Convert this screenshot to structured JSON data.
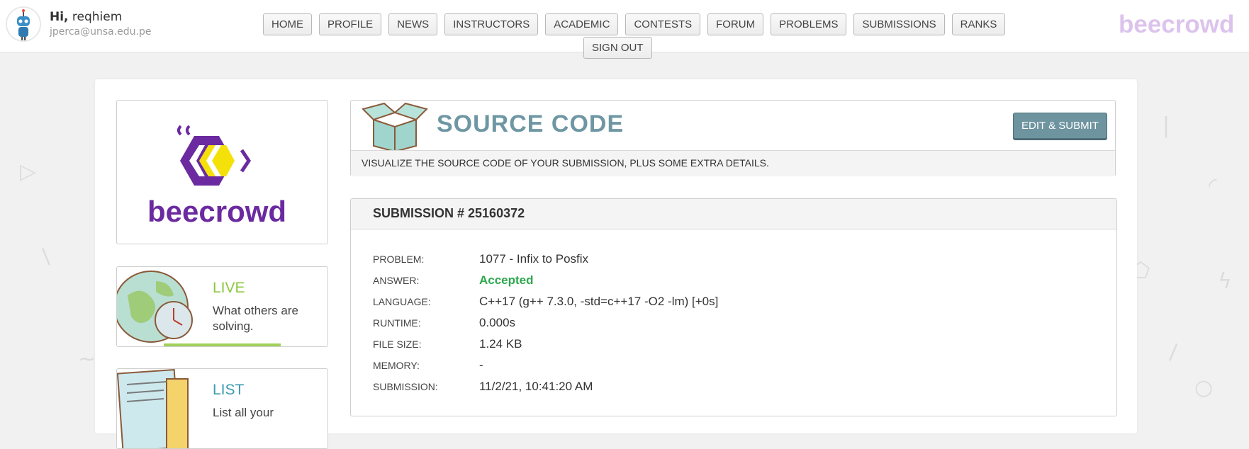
{
  "user": {
    "greeting_prefix": "Hi,",
    "name": "reqhiem",
    "email": "jperca@unsa.edu.pe",
    "avatar_icon": "robot-avatar-icon"
  },
  "nav": [
    {
      "label": "HOME"
    },
    {
      "label": "PROFILE"
    },
    {
      "label": "NEWS"
    },
    {
      "label": "INSTRUCTORS"
    },
    {
      "label": "ACADEMIC"
    },
    {
      "label": "CONTESTS"
    },
    {
      "label": "FORUM"
    },
    {
      "label": "PROBLEMS"
    },
    {
      "label": "SUBMISSIONS"
    },
    {
      "label": "RANKS"
    }
  ],
  "signout_label": "SIGN OUT",
  "brand": "beecrowd",
  "colors": {
    "brand_purple": "#6b2aa0",
    "brand_light": "#dcc3ec",
    "accent_teal": "#6e97a3",
    "accepted_green": "#2ea84f",
    "live_green": "#8cc63f",
    "list_teal": "#3b9bb0"
  },
  "sidebar": {
    "logo_text": "beecrowd",
    "cards": [
      {
        "title": "LIVE",
        "desc": "What others are solving.",
        "icon": "globe-clock-icon"
      },
      {
        "title": "LIST",
        "desc": "List all your",
        "icon": "paper-list-icon"
      }
    ]
  },
  "source": {
    "title": "SOURCE CODE",
    "subtitle": "VISUALIZE THE SOURCE CODE OF YOUR SUBMISSION, PLUS SOME EXTRA DETAILS.",
    "edit_label": "EDIT & SUBMIT",
    "icon": "open-box-icon"
  },
  "submission": {
    "header": "SUBMISSION # 25160372",
    "rows": [
      {
        "key": "PROBLEM:",
        "value": "1077 - Infix to Posfix"
      },
      {
        "key": "ANSWER:",
        "value": "Accepted"
      },
      {
        "key": "LANGUAGE:",
        "value": "C++17 (g++ 7.3.0, -std=c++17 -O2 -lm) [+0s]"
      },
      {
        "key": "RUNTIME:",
        "value": "0.000s"
      },
      {
        "key": "FILE SIZE:",
        "value": "1.24 KB"
      },
      {
        "key": "MEMORY:",
        "value": "-"
      },
      {
        "key": "SUBMISSION:",
        "value": "11/2/21, 10:41:20 AM"
      }
    ]
  }
}
